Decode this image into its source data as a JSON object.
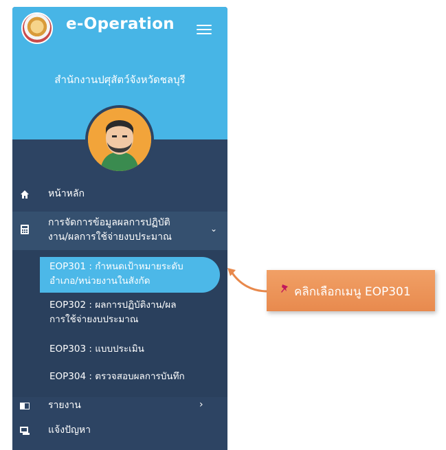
{
  "header": {
    "app_title": "e-Operation",
    "org_name": "สำนักงานปศุสัตว์จังหวัดชลบุรี"
  },
  "menu": {
    "home": "หน้าหลัก",
    "manage_line1": "การจัดการข้อมูลผลการปฏิบัติ",
    "manage_line2": "งาน/ผลการใช้จ่ายงบประมาณ",
    "sub": [
      {
        "line1": "EOP301 : กำหนดเป้าหมายระดับ",
        "line2": "อำเภอ/หน่วยงานในสังกัด"
      },
      {
        "line1": "EOP302 : ผลการปฏิบัติงาน/ผล",
        "line2": "การใช้จ่ายงบประมาณ"
      },
      {
        "line1": "EOP303 : แบบประเมิน",
        "line2": ""
      },
      {
        "line1": "EOP304 : ตรวจสอบผลการบันทึก",
        "line2": ""
      }
    ],
    "report": "รายงาน",
    "problem": "แจ้งปัญหา"
  },
  "callout": {
    "text": "คลิกเลือกเมนู EOP301"
  },
  "colors": {
    "sidebar_dark": "#2d4463",
    "header_blue": "#47b5e6",
    "active_blue": "#4cb8e8",
    "callout_orange": "#ec9257"
  },
  "icons": [
    "emblem-logo",
    "hamburger-icon",
    "home-icon",
    "calculator-icon",
    "chevron-down-icon",
    "report-icon",
    "chevron-right-icon",
    "chat-icon",
    "pin-icon"
  ]
}
